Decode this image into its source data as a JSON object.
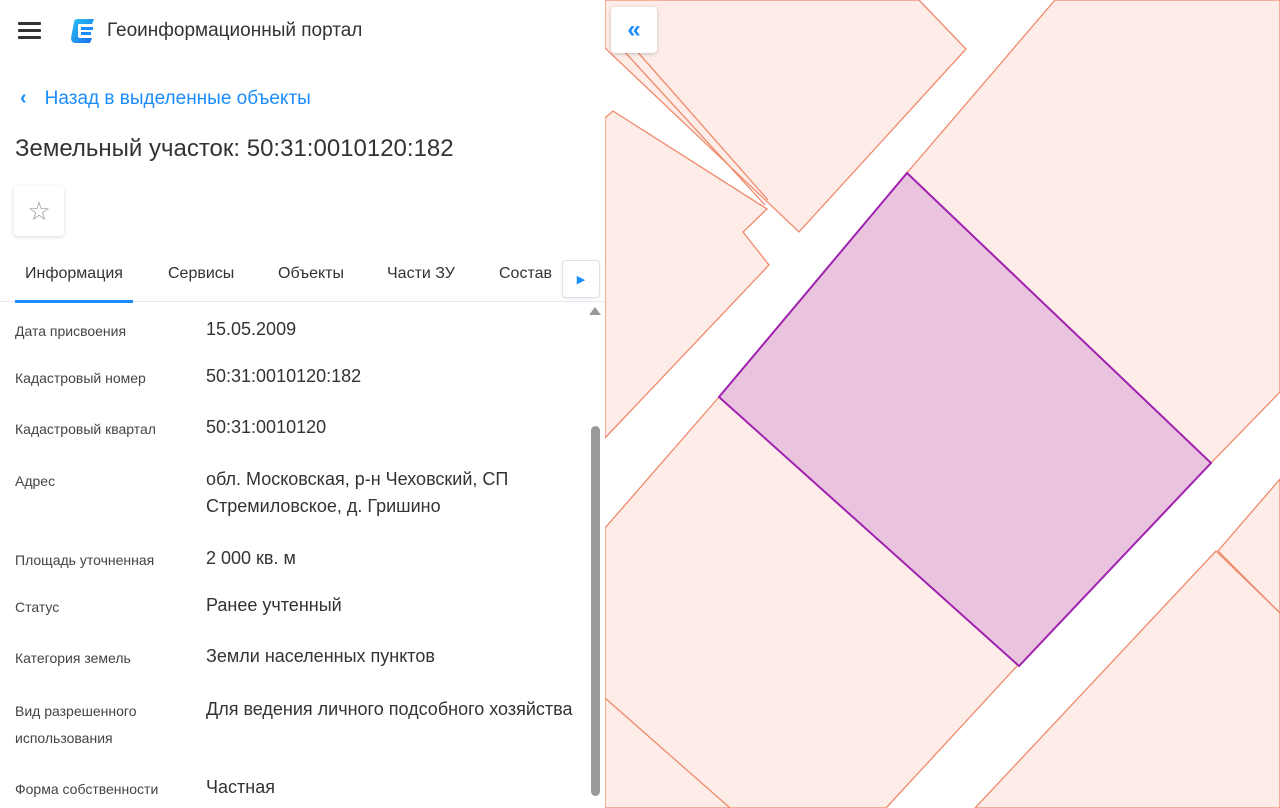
{
  "header": {
    "title": "Геоинформационный портал",
    "menu_icon": "hamburger-icon",
    "logo_icon": "portal-logo"
  },
  "back_link": {
    "label": "Назад в выделенные объекты"
  },
  "object": {
    "title": "Земельный участок: 50:31:0010120:182"
  },
  "tabs": [
    {
      "label": "Информация",
      "active": true
    },
    {
      "label": "Сервисы"
    },
    {
      "label": "Объекты"
    },
    {
      "label": "Части ЗУ"
    },
    {
      "label": "Состав"
    }
  ],
  "info": [
    {
      "label": "Дата присвоения",
      "value": "15.05.2009"
    },
    {
      "label": "Кадастровый номер",
      "value": "50:31:0010120:182"
    },
    {
      "label": "Кадастровый квартал",
      "value": "50:31:0010120"
    },
    {
      "label": "Адрес",
      "value": "обл. Московская, р-н Чеховский, СП Стремиловское, д. Гришино"
    },
    {
      "label": "Площадь уточненная",
      "value": "2 000 кв. м"
    },
    {
      "label": "Статус",
      "value": "Ранее учтенный"
    },
    {
      "label": "Категория земель",
      "value": "Земли населенных пунктов"
    },
    {
      "label": "Вид разрешенного использования",
      "value": "Для ведения личного подсобного хозяйства"
    },
    {
      "label": "Форма собственности",
      "value": "Частная"
    }
  ],
  "colors": {
    "accent": "#1a8cff",
    "parcel_fill": "#fdece7",
    "parcel_stroke": "#f08a6c",
    "selected_fill": "#eac4de",
    "selected_stroke": "#a020b0"
  }
}
